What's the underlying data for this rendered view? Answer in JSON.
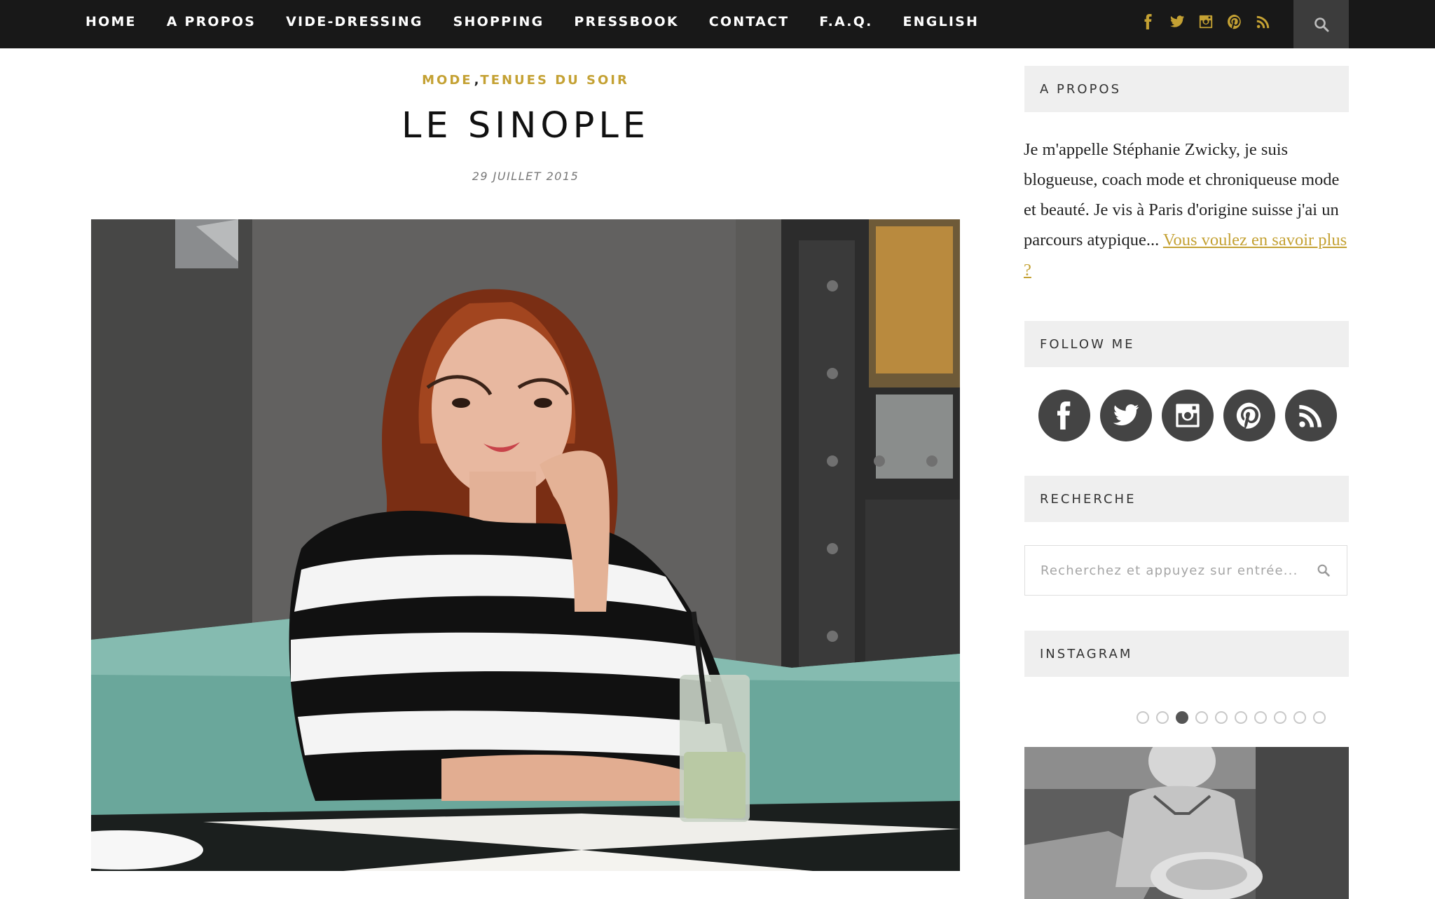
{
  "nav": {
    "items": [
      "HOME",
      "A PROPOS",
      "VIDE-DRESSING",
      "SHOPPING",
      "PRESSBOOK",
      "CONTACT",
      "F.A.Q.",
      "ENGLISH"
    ],
    "social_icons": [
      "facebook-icon",
      "twitter-icon",
      "instagram-icon",
      "pinterest-icon",
      "rss-icon"
    ],
    "search_icon": "search-icon"
  },
  "post": {
    "category_1": "MODE",
    "category_sep": ",",
    "category_2": "TENUES DU SOIR",
    "title": "LE SINOPLE",
    "date": "29 JUILLET 2015"
  },
  "sidebar": {
    "about": {
      "title": "A PROPOS",
      "text": "Je m'appelle Stéphanie Zwicky, je suis blogueuse, coach mode et chroniqueuse mode et beauté. Je vis à Paris d'origine suisse j'ai un parcours atypique...",
      "more_link": "Vous voulez en savoir plus ?"
    },
    "follow": {
      "title": "FOLLOW ME",
      "icons": [
        "facebook-icon",
        "twitter-icon",
        "instagram-icon",
        "pinterest-icon",
        "rss-icon"
      ]
    },
    "search": {
      "title": "RECHERCHE",
      "placeholder": "Recherchez et appuyez sur entrée..."
    },
    "instagram": {
      "title": "INSTAGRAM",
      "slide_count": 10,
      "active_slide": 3
    }
  },
  "colors": {
    "accent": "#c4a133",
    "topbar": "#181818",
    "widget_bg": "#efefef",
    "social_circle": "#444444"
  }
}
